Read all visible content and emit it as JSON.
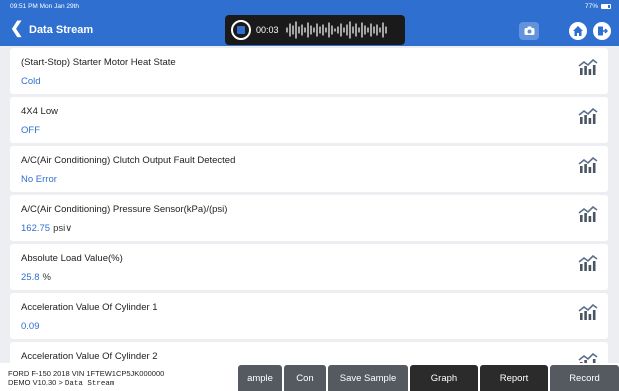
{
  "status_bar": {
    "time": "09:51 PM  Mon Jan 29th",
    "battery": "77%"
  },
  "header": {
    "back_icon": "chevron-left",
    "title": "Data Stream"
  },
  "recorder": {
    "time": "00:03"
  },
  "rows": [
    {
      "name": "(Start-Stop) Starter Motor Heat State",
      "value": "Cold",
      "unit": ""
    },
    {
      "name": "4X4 Low",
      "value": "OFF",
      "unit": ""
    },
    {
      "name": "A/C(Air Conditioning) Clutch Output Fault Detected",
      "value": "No Error",
      "unit": ""
    },
    {
      "name": "A/C(Air Conditioning) Pressure Sensor(kPa)/(psi)",
      "value": "162.75",
      "unit": "psi∨"
    },
    {
      "name": "Absolute Load Value(%)",
      "value": "25.8",
      "unit": "%"
    },
    {
      "name": "Acceleration Value Of Cylinder 1",
      "value": "0.09",
      "unit": ""
    },
    {
      "name": "Acceleration Value Of Cylinder 2",
      "value": "",
      "unit": ""
    }
  ],
  "bottom": {
    "vehicle_line": "FORD  F-150  2018  VIN  1FTEW1CP5JK000000",
    "version": "DEMO V10.30 >",
    "path": "Data Stream",
    "buttons": [
      "ample",
      "Con",
      "Save Sample",
      "Graph",
      "Report",
      "Record"
    ]
  },
  "colors": {
    "accent": "#2f6fd0",
    "button_gray": "#555a60",
    "button_dark": "#2b2b2b"
  }
}
